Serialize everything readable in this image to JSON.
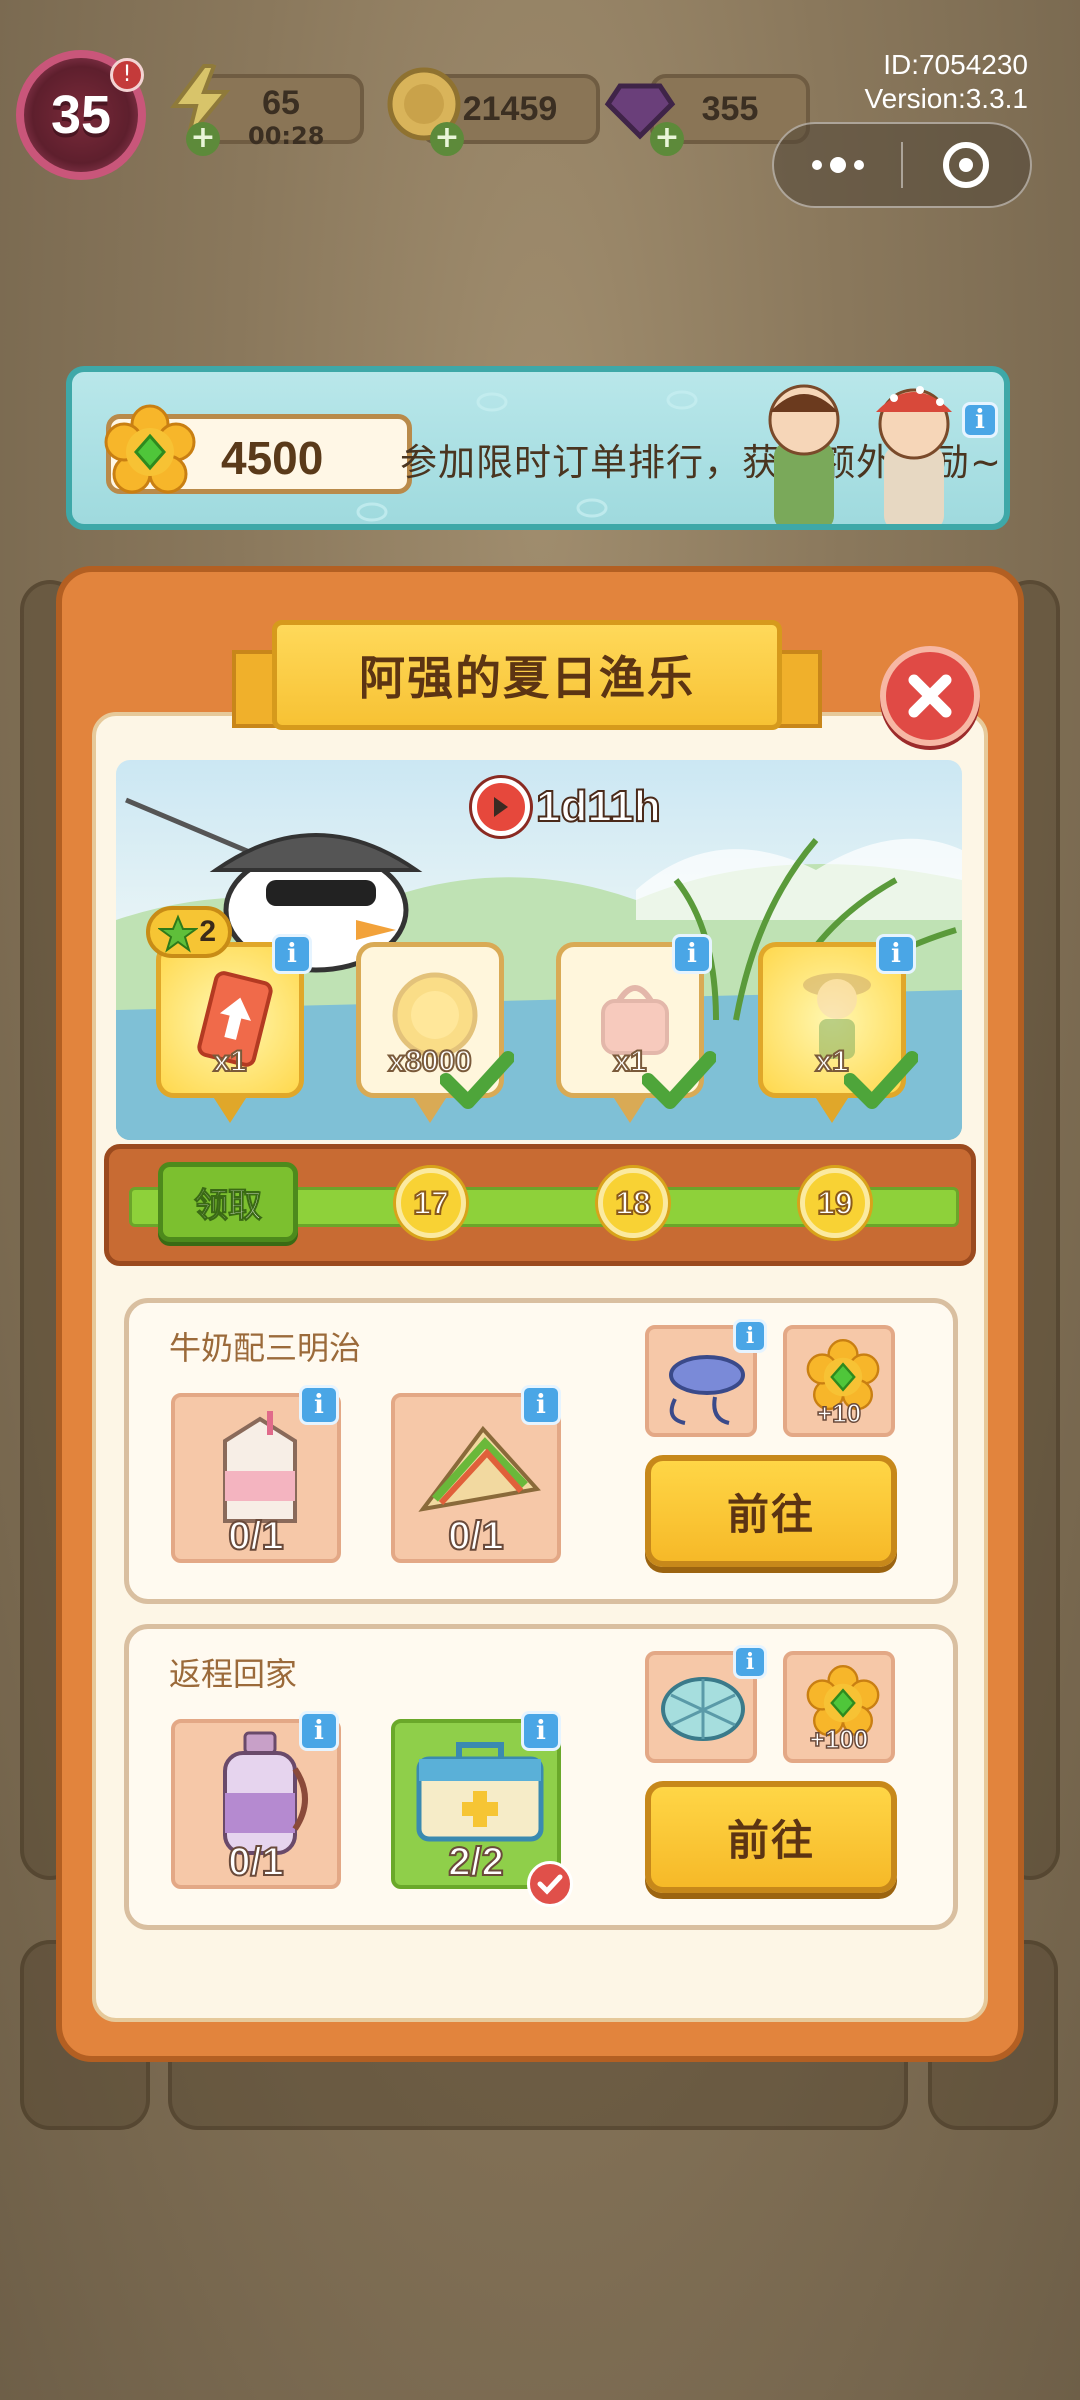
{
  "hud": {
    "level": "35",
    "energy": {
      "value": "65",
      "timer": "00:28"
    },
    "coins": {
      "value": "21459"
    },
    "gems": {
      "value": "355"
    },
    "id_text": "ID:7054230",
    "version_text": "Version:3.3.1"
  },
  "banner": {
    "points": "4500",
    "text": "参加限时订单排行，获得额外奖励~"
  },
  "event": {
    "title": "阿强的夏日渔乐",
    "timer": "1d11h",
    "star_count": "2",
    "rewards": [
      {
        "name": "upgrade-card",
        "qty": "x1",
        "claimed": false
      },
      {
        "name": "coin",
        "qty": "x8000",
        "claimed": true
      },
      {
        "name": "handbag",
        "qty": "x1",
        "claimed": true
      },
      {
        "name": "explorer-kid",
        "qty": "x1",
        "claimed": true
      }
    ],
    "claim_label": "领取",
    "milestones": [
      "17",
      "18",
      "19"
    ]
  },
  "orders": [
    {
      "title": "牛奶配三明治",
      "items": [
        {
          "name": "milk-carton",
          "count": "0/1",
          "done": false
        },
        {
          "name": "sandwich",
          "count": "0/1",
          "done": false
        }
      ],
      "reward_item": "fishing-lure",
      "reward_points": "+10",
      "go_label": "前往"
    },
    {
      "title": "返程回家",
      "items": [
        {
          "name": "water-bottle",
          "count": "0/1",
          "done": false
        },
        {
          "name": "first-aid-kit",
          "count": "2/2",
          "done": true
        }
      ],
      "reward_item": "fishing-net",
      "reward_points": "+100",
      "go_label": "前往"
    }
  ],
  "colors": {
    "panel": "#e2843d",
    "ribbon": "#f7c234",
    "progress": "#8ed13a",
    "go_button": "#f6b928",
    "close": "#e04a45"
  }
}
